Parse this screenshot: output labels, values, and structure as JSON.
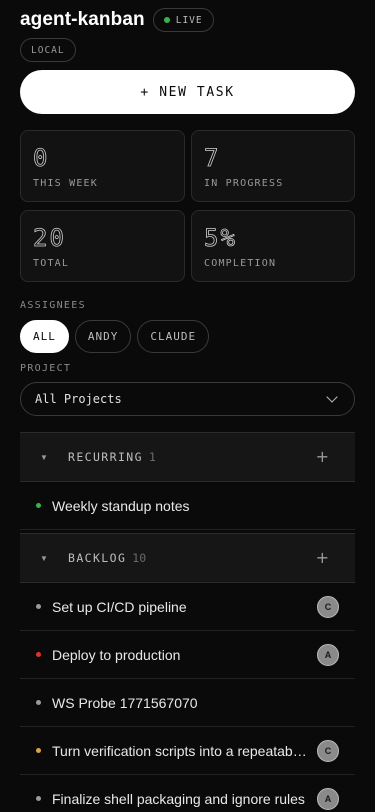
{
  "app": {
    "title": "agent-kanban",
    "live_label": "LIVE",
    "env_label": "LOCAL"
  },
  "actions": {
    "new_task": "+ NEW TASK"
  },
  "stats": [
    {
      "value": "0",
      "label": "THIS WEEK"
    },
    {
      "value": "7",
      "label": "IN PROGRESS"
    },
    {
      "value": "20",
      "label": "TOTAL"
    },
    {
      "value": "5%",
      "label": "COMPLETION"
    }
  ],
  "filters": {
    "assignees_label": "ASSIGNEES",
    "assignees": [
      "ALL",
      "ANDY",
      "CLAUDE"
    ],
    "selected_assignee": "ALL",
    "project_label": "PROJECT",
    "project_value": "All Projects"
  },
  "groups": [
    {
      "name": "RECURRING",
      "count": "1",
      "add": "+"
    },
    {
      "name": "BACKLOG",
      "count": "10",
      "add": "+"
    }
  ],
  "tasks": [
    {
      "title": "Weekly standup notes",
      "dot_color": "#3bb34a",
      "assignee": ""
    },
    {
      "title": "Set up CI/CD pipeline",
      "dot_color": "#9a9a9a",
      "assignee": "C"
    },
    {
      "title": "Deploy to production",
      "dot_color": "#e03131",
      "assignee": "A"
    },
    {
      "title": "WS Probe 1771567070",
      "dot_color": "#9a9a9a",
      "assignee": ""
    },
    {
      "title": "Turn verification scripts into a repeatable test suite",
      "dot_color": "#d9a441",
      "assignee": "C"
    },
    {
      "title": "Finalize shell packaging and ignore rules",
      "dot_color": "#9a9a9a",
      "assignee": "A"
    }
  ],
  "colors": {
    "accent_live": "#3bb34a",
    "background": "#0a0a0a",
    "surface": "#161616"
  }
}
